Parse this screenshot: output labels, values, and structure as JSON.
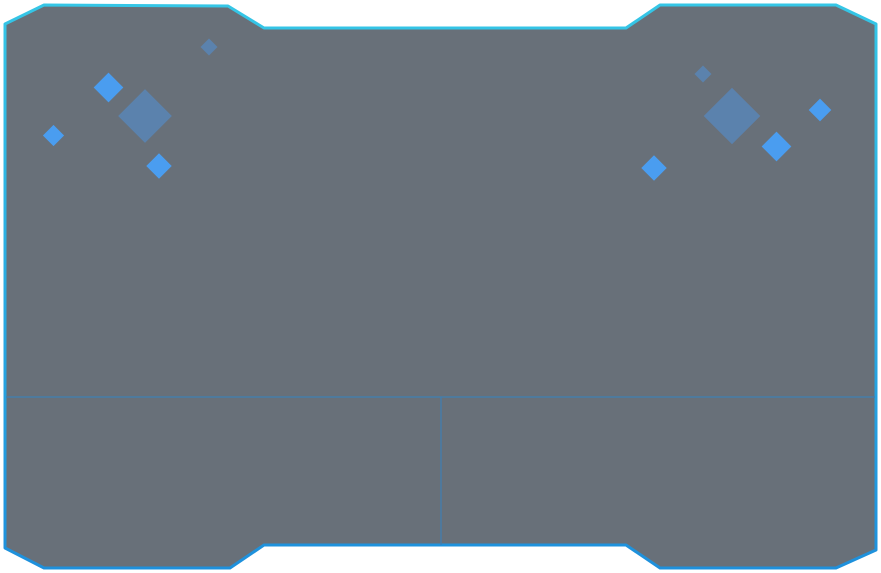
{
  "device": {
    "name": "touchpad",
    "colors": {
      "body": "#687079",
      "border_light": "#35c6e6",
      "border_dark": "#1e90dc",
      "divider": "#3f7fb3",
      "diamond_bright": "#4a9df0",
      "diamond_dim": "#5b82ad"
    }
  },
  "left_cluster": {
    "icon": "diamond-sparkle-icon"
  },
  "right_cluster": {
    "icon": "diamond-sparkle-icon"
  },
  "click_zones": [
    {
      "id": "left-click-zone",
      "button": "left"
    },
    {
      "id": "right-click-zone",
      "button": "right"
    }
  ]
}
